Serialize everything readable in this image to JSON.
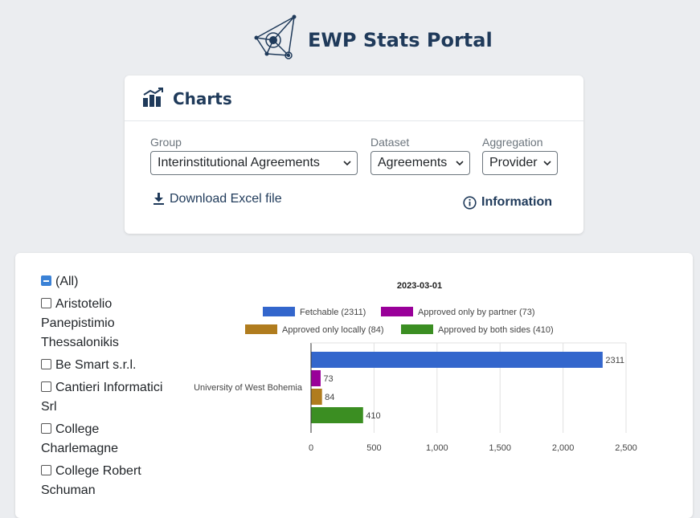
{
  "header": {
    "title": "EWP Stats Portal",
    "logo_icon": "network-logo-icon"
  },
  "charts_panel": {
    "title": "Charts",
    "group": {
      "label": "Group",
      "value": "Interinstitutional Agreements"
    },
    "dataset": {
      "label": "Dataset",
      "value": "Agreements"
    },
    "aggregation": {
      "label": "Aggregation",
      "value": "Provider"
    },
    "download_label": "Download Excel file",
    "information_label": "Information"
  },
  "filters": {
    "items": [
      {
        "label": "(All)",
        "state": "partial"
      },
      {
        "label": "Aristotelio Panepistimio Thessalonikis",
        "state": "unchecked"
      },
      {
        "label": "Be Smart s.r.l.",
        "state": "unchecked"
      },
      {
        "label": "Cantieri Informatici Srl",
        "state": "unchecked"
      },
      {
        "label": "College Charlemagne",
        "state": "unchecked"
      },
      {
        "label": "College Robert Schuman",
        "state": "unchecked"
      }
    ]
  },
  "colors": {
    "fetchable": "#3366cc",
    "partner": "#990099",
    "locally": "#b07c1e",
    "both": "#3b8e22"
  },
  "chart_data": {
    "type": "bar",
    "orientation": "horizontal",
    "title": "2023-03-01",
    "categories": [
      "University of West Bohemia"
    ],
    "series": [
      {
        "name": "Fetchable (2311)",
        "values": [
          2311
        ]
      },
      {
        "name": "Approved only by partner (73)",
        "values": [
          73
        ]
      },
      {
        "name": "Approved only locally (84)",
        "values": [
          84
        ]
      },
      {
        "name": "Approved by both sides (410)",
        "values": [
          410
        ]
      }
    ],
    "xlim": [
      0,
      2500
    ],
    "xticks": [
      "0",
      "500",
      "1,000",
      "1,500",
      "2,000",
      "2,500"
    ],
    "xtick_values": [
      0,
      500,
      1000,
      1500,
      2000,
      2500
    ],
    "grid": true,
    "legend_position": "top"
  }
}
